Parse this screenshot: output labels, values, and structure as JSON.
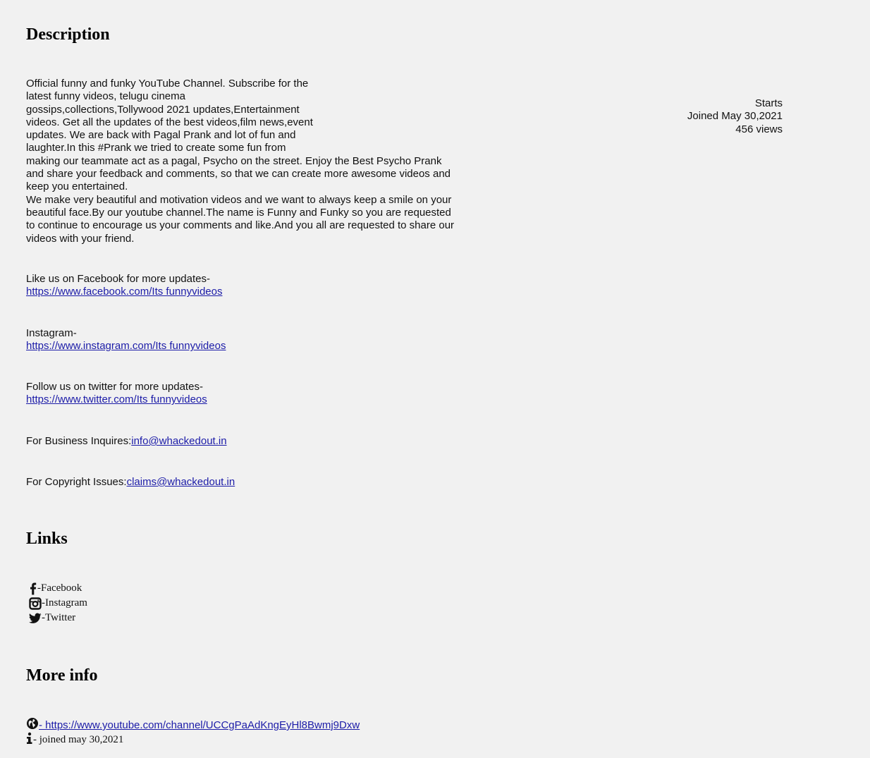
{
  "description": {
    "heading": "Description",
    "lines": [
      "Official funny and funky YouTube Channel. Subscribe for the",
      "latest funny videos, telugu cinema",
      "gossips,collections,Tollywood 2021 updates,Entertainment",
      "videos. Get all the updates of the best videos,film news,event",
      "updates. We are back with Pagal Prank and lot of fun and",
      "laughter.In this #Prank we tried to create some fun from",
      "making our teammate act as a pagal, Psycho on the street. Enjoy the Best Psycho Prank",
      "and share your feedback and comments, so that we can create more awesome videos and",
      "keep you entertained.",
      "We make very beautiful and motivation videos and we want to always keep a smile on your",
      "beautiful face.By our youtube channel.The name is Funny and Funky so you are requested",
      "to continue to encourage us your comments and like.And you all are requested to share our",
      "videos with your friend."
    ],
    "facebook_text": "Like us on Facebook for more updates-",
    "facebook_url": "https://www.facebook.com/Its funnyvideos",
    "instagram_text": "Instagram-",
    "instagram_url": "https://www.instagram.com/Its funnyvideos",
    "twitter_text": "Follow us on twitter for more updates-",
    "twitter_url": "https://www.twitter.com/Its funnyvideos",
    "business_text": "For Business Inquires:",
    "business_email": "info@whackedout.in",
    "copyright_text": "For Copyright Issues:",
    "copyright_email": "claims@whackedout.in"
  },
  "stats": {
    "starts": "Starts",
    "joined": "Joined May 30,2021",
    "views": "456 views"
  },
  "links": {
    "heading": "Links",
    "items": [
      {
        "icon": "facebook-icon",
        "label": "-Facebook"
      },
      {
        "icon": "instagram-icon",
        "label": "-Instagram"
      },
      {
        "icon": "twitter-icon",
        "label": "-Twitter"
      }
    ]
  },
  "more_info": {
    "heading": "More info",
    "channel_url": " - https://www.youtube.com/channel/UCCgPaAdKngEyHl8Bwmj9Dxw",
    "joined": " - joined may 30,2021",
    "icons": [
      "globe-icon",
      "info-icon"
    ]
  }
}
